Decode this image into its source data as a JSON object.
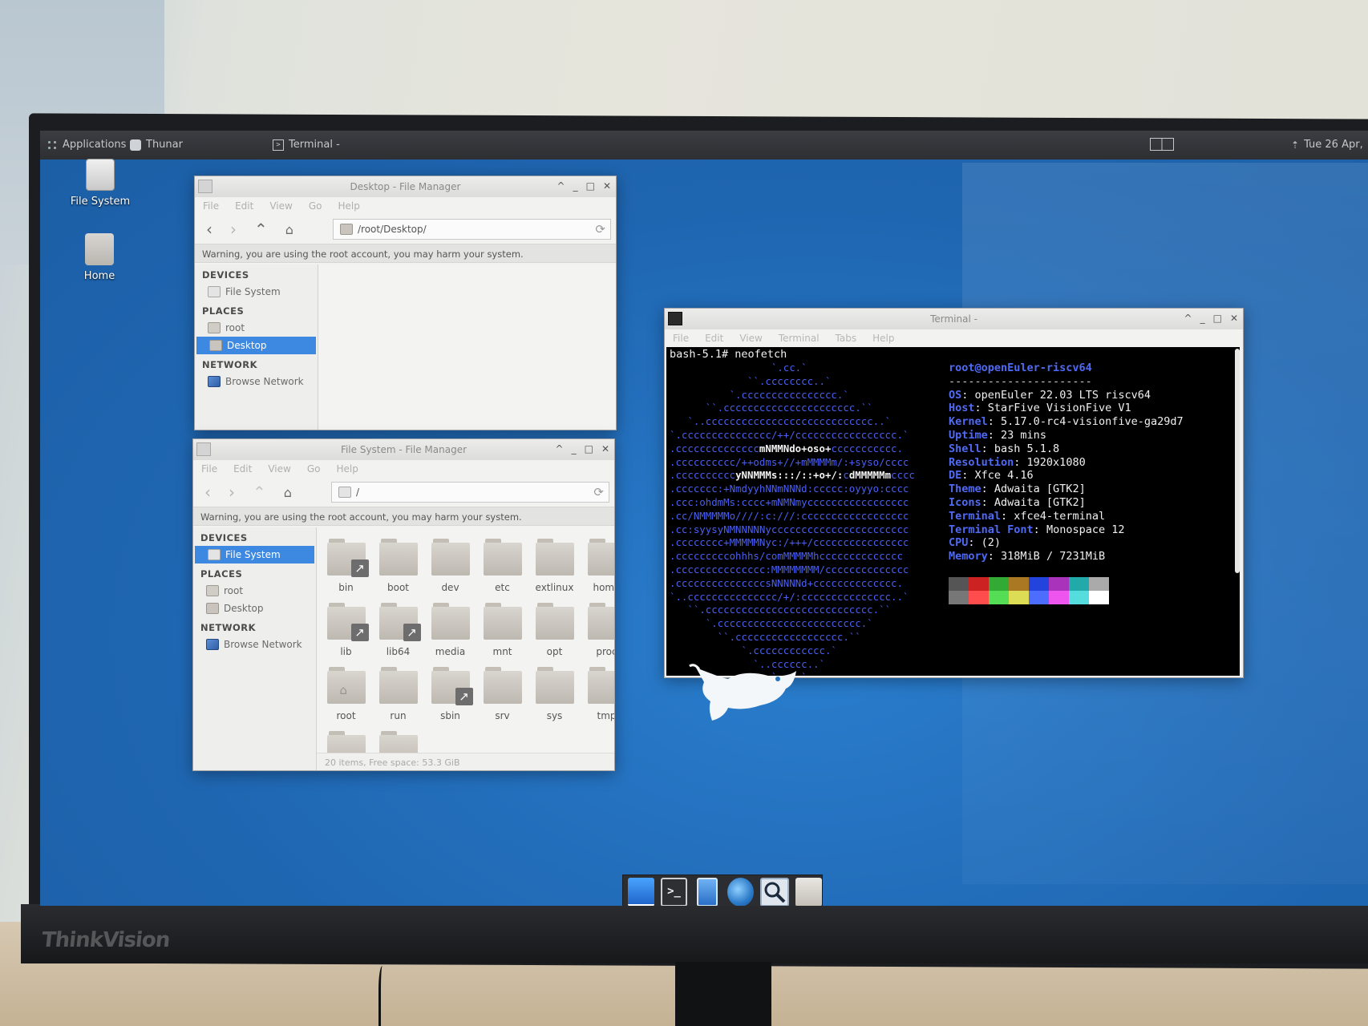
{
  "monitor": {
    "brand": "ThinkVision"
  },
  "panel": {
    "applications_label": "Applications",
    "thunar_label": "Thunar",
    "terminal_label": "Terminal -",
    "clock": "Tue 26 Apr,"
  },
  "desktop_icons": [
    {
      "label": "File System",
      "icon": "drive-icon"
    },
    {
      "label": "Home",
      "icon": "home-folder-icon"
    }
  ],
  "desktop_fm": {
    "title": "Desktop - File Manager",
    "menu": [
      "File",
      "Edit",
      "View",
      "Go",
      "Help"
    ],
    "location": "/root/Desktop/",
    "warning": "Warning, you are using the root account, you may harm your system.",
    "sidebar": {
      "devices_header": "DEVICES",
      "devices": [
        "File System"
      ],
      "places_header": "PLACES",
      "places": [
        "root",
        "Desktop"
      ],
      "network_header": "NETWORK",
      "network": [
        "Browse Network"
      ],
      "selected": "Desktop"
    }
  },
  "fs_fm": {
    "title": "File System - File Manager",
    "menu": [
      "File",
      "Edit",
      "View",
      "Go",
      "Help"
    ],
    "location": "/",
    "warning": "Warning, you are using the root account, you may harm your system.",
    "sidebar": {
      "devices_header": "DEVICES",
      "devices": [
        "File System"
      ],
      "places_header": "PLACES",
      "places": [
        "root",
        "Desktop"
      ],
      "network_header": "NETWORK",
      "network": [
        "Browse Network"
      ],
      "selected": "File System"
    },
    "files": [
      {
        "name": "bin",
        "link": true
      },
      {
        "name": "boot",
        "link": false
      },
      {
        "name": "dev",
        "link": false
      },
      {
        "name": "etc",
        "link": false
      },
      {
        "name": "extlinux",
        "link": false
      },
      {
        "name": "home",
        "link": false
      },
      {
        "name": "lib",
        "link": true
      },
      {
        "name": "lib64",
        "link": true
      },
      {
        "name": "media",
        "link": false
      },
      {
        "name": "mnt",
        "link": false
      },
      {
        "name": "opt",
        "link": false
      },
      {
        "name": "proc",
        "link": false
      },
      {
        "name": "root",
        "link": false,
        "home": true
      },
      {
        "name": "run",
        "link": false
      },
      {
        "name": "sbin",
        "link": true
      },
      {
        "name": "srv",
        "link": false
      },
      {
        "name": "sys",
        "link": false
      },
      {
        "name": "tmp",
        "link": false
      },
      {
        "name": "",
        "link": false
      },
      {
        "name": "",
        "link": false
      }
    ],
    "status": "20 items, Free space: 53.3 GiB"
  },
  "terminal": {
    "title": "Terminal -",
    "menu": [
      "File",
      "Edit",
      "View",
      "Terminal",
      "Tabs",
      "Help"
    ],
    "prompt": "bash-5.1# neofetch",
    "user_host": "root@openEuler-riscv64",
    "separator": "----------------------",
    "info": [
      {
        "key": "OS",
        "value": "openEuler 22.03 LTS riscv64"
      },
      {
        "key": "Host",
        "value": "StarFive VisionFive V1"
      },
      {
        "key": "Kernel",
        "value": "5.17.0-rc4-visionfive-ga29d7"
      },
      {
        "key": "Uptime",
        "value": "23 mins"
      },
      {
        "key": "Shell",
        "value": "bash 5.1.8"
      },
      {
        "key": "Resolution",
        "value": "1920x1080"
      },
      {
        "key": "DE",
        "value": "Xfce 4.16"
      },
      {
        "key": "Theme",
        "value": "Adwaita [GTK2]"
      },
      {
        "key": "Icons",
        "value": "Adwaita [GTK2]"
      },
      {
        "key": "Terminal",
        "value": "xfce4-terminal"
      },
      {
        "key": "Terminal Font",
        "value": "Monospace 12"
      },
      {
        "key": "CPU",
        "value": "(2)"
      },
      {
        "key": "Memory",
        "value": "318MiB / 7231MiB"
      }
    ],
    "palette": [
      "#555555",
      "#cc2222",
      "#33aa33",
      "#aa7722",
      "#2244dd",
      "#aa33bb",
      "#22aaaa",
      "#aaaaaa",
      "#777777",
      "#ff4d4d",
      "#55dd55",
      "#dddd55",
      "#4d6dff",
      "#ee55ee",
      "#55dddd",
      "#ffffff"
    ],
    "logo_color": "#4a5ff2",
    "accent_color": "#4f6af5"
  },
  "dock": {
    "items": [
      "show-desktop-icon",
      "terminal-icon",
      "file-manager-icon",
      "web-browser-icon",
      "app-finder-icon",
      "home-folder-icon"
    ]
  },
  "colors": {
    "desktop_bg": "#2471bf",
    "selection": "#3d88e0",
    "panel_bg": "#2d2f33"
  }
}
